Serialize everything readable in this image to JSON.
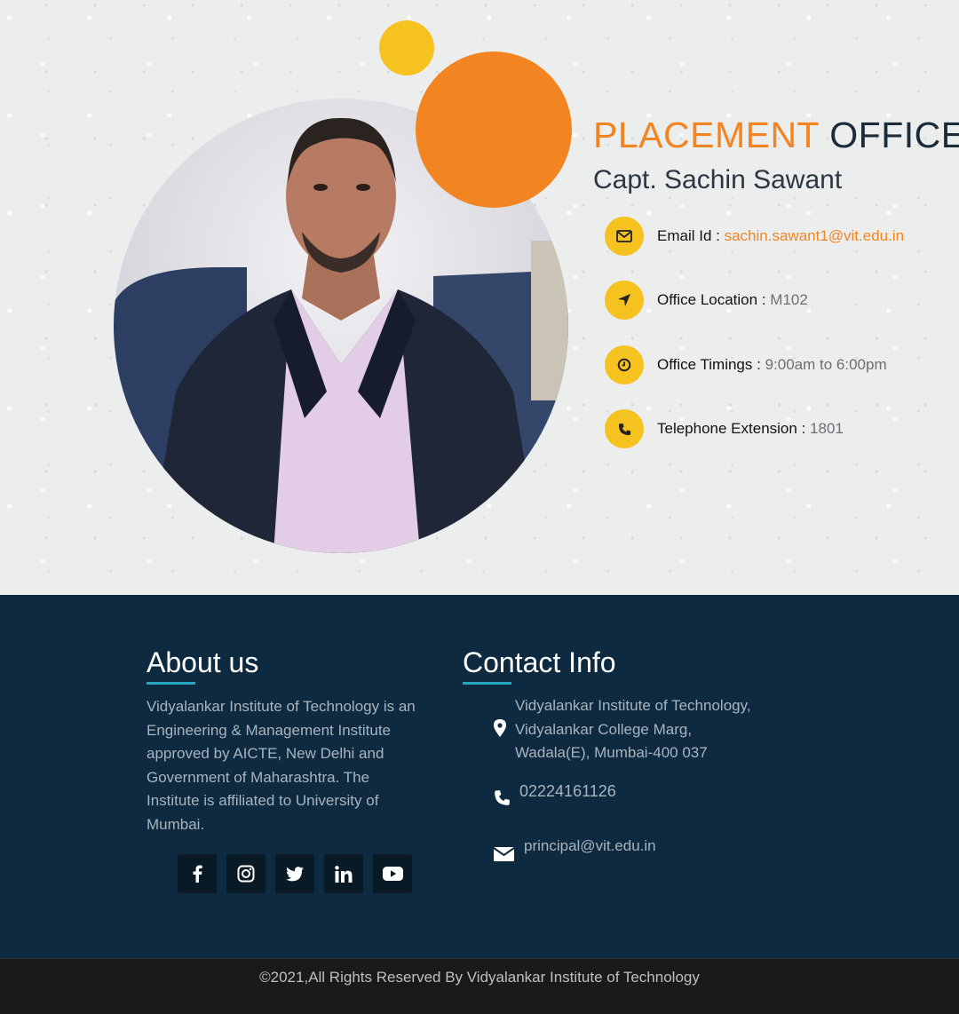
{
  "hero": {
    "title_highlight": "PLACEMENT",
    "title_rest": "OFFICER",
    "name": "Capt. Sachin Sawant",
    "photo_alt": "",
    "info": [
      {
        "icon": "envelope-icon",
        "label": "Email Id :",
        "value": "sachin.sawant1@vit.edu.in"
      },
      {
        "icon": "location-arrow-icon",
        "label": "Office Location :",
        "value": "M102"
      },
      {
        "icon": "clock-icon",
        "label": "Office Timings :",
        "value": "9:00am to 6:00pm"
      },
      {
        "icon": "phone-icon",
        "label": "Telephone Extension :",
        "value": "1801"
      }
    ]
  },
  "footer": {
    "about_heading": "About us",
    "about_text": "Vidyalankar Institute of Technology is an Engineering & Management Institute approved by AICTE, New Delhi and Government of Maharashtra. The Institute is affiliated to University of Mumbai.",
    "social": [
      "facebook-icon",
      "instagram-icon",
      "twitter-icon",
      "linkedin-icon",
      "youtube-icon"
    ],
    "contact_heading": "Contact Info",
    "address_lines": [
      "Vidyalankar Institute of Technology,",
      "Vidyalankar College Marg,",
      "Wadala(E), Mumbai-400 037"
    ],
    "phone": "02224161126",
    "email": "principal@vit.edu.in"
  },
  "copyright": "©2021,All Rights Reserved By Vidyalankar Institute of Technology",
  "colors": {
    "accent_orange": "#f28522",
    "accent_yellow": "#f5c21f",
    "footer_bg": "#0d2a40",
    "underline": "#2aa4c3"
  }
}
